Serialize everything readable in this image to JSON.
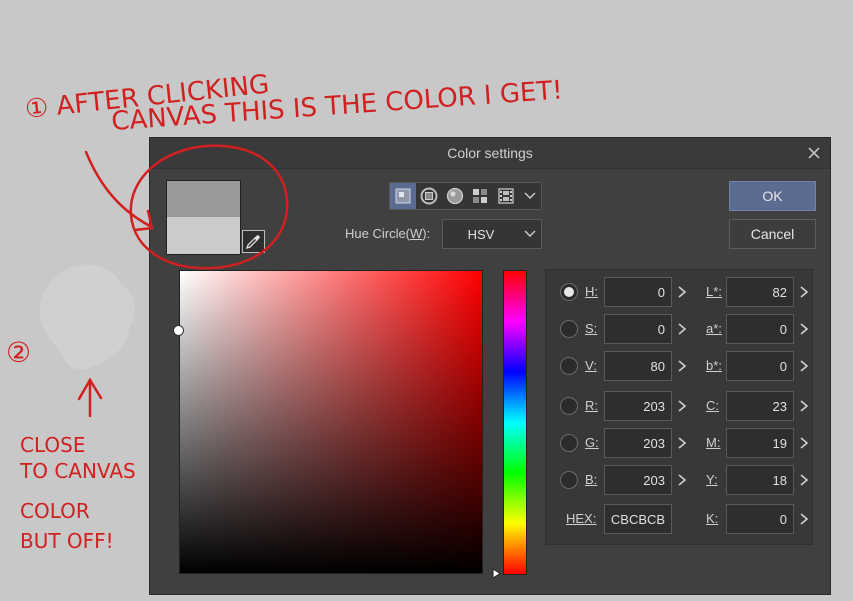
{
  "dialog": {
    "title": "Color settings",
    "ok_label": "OK",
    "cancel_label": "Cancel",
    "hue_circle": {
      "label_prefix": "Hue Circle(",
      "label_key": "W",
      "label_suffix": "):",
      "value": "HSV"
    },
    "color_mode_icons": [
      "color-square-icon",
      "hue-ring-icon",
      "color-wheel-icon",
      "color-grid-icon",
      "filmstrip-icon",
      "chevron-down-icon"
    ]
  },
  "swatches": {
    "previous_hex": "#999999",
    "current_hex": "#CBCBCB"
  },
  "left_fields": [
    {
      "key": "H",
      "suffix": ":",
      "value": "0",
      "selected": true
    },
    {
      "key": "S",
      "suffix": ":",
      "value": "0",
      "selected": false
    },
    {
      "key": "V",
      "suffix": ":",
      "value": "80",
      "selected": false
    },
    {
      "key": "R",
      "suffix": ":",
      "value": "203",
      "selected": false
    },
    {
      "key": "G",
      "suffix": ":",
      "value": "203",
      "selected": false
    },
    {
      "key": "B",
      "suffix": ":",
      "value": "203",
      "selected": false
    },
    {
      "key": "HEX",
      "suffix": ":",
      "value": "CBCBCB",
      "selected": false
    }
  ],
  "right_fields": [
    {
      "key": "L*",
      "suffix": ":",
      "value": "82"
    },
    {
      "key": "a*",
      "suffix": ":",
      "value": "0"
    },
    {
      "key": "b*",
      "suffix": ":",
      "value": "0"
    },
    {
      "key": "C",
      "suffix": ":",
      "value": "23"
    },
    {
      "key": "M",
      "suffix": ":",
      "value": "19"
    },
    {
      "key": "Y",
      "suffix": ":",
      "value": "18"
    },
    {
      "key": "K",
      "suffix": ":",
      "value": "0"
    }
  ],
  "annotations": {
    "note1_line1": "① AFTER CLICKING",
    "note1_line2": "CANVAS THIS IS THE COLOR I GET!",
    "note2_number": "②",
    "note2_line1": "CLOSE",
    "note2_line2": "TO CANVAS",
    "note2_line3": "COLOR",
    "note2_line4": "BUT OFF!",
    "ink_color": "#d21f1f"
  }
}
